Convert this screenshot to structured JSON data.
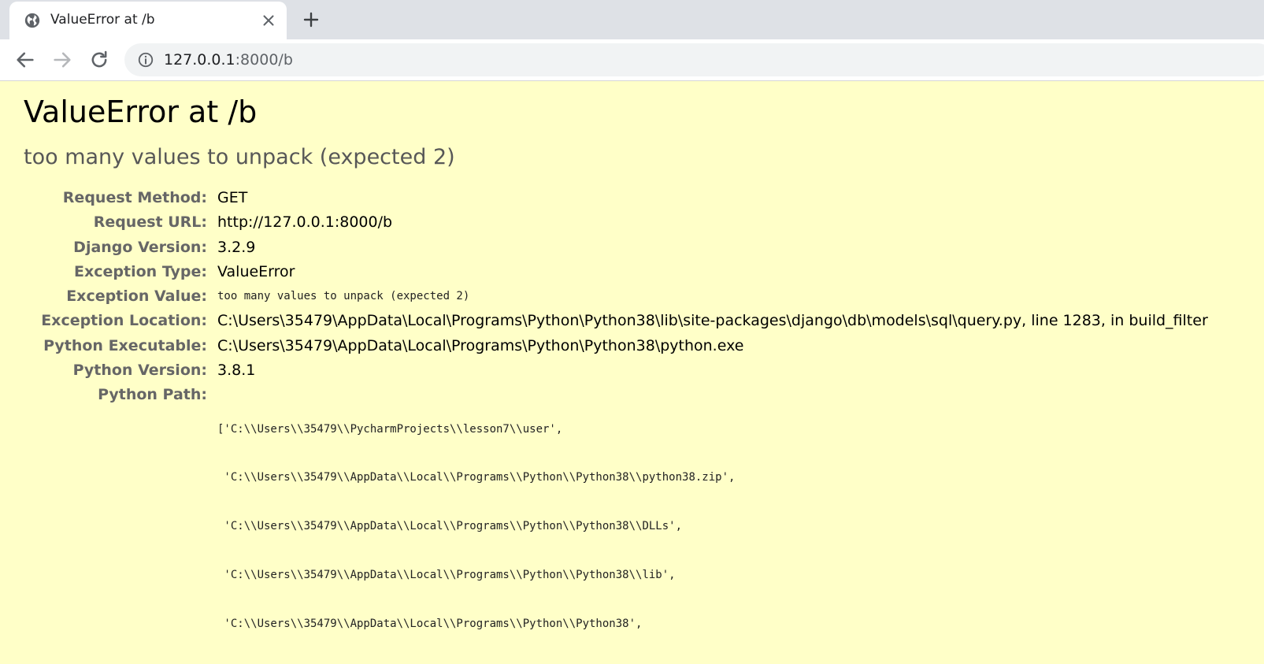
{
  "browser": {
    "tab_title": "ValueError at /b",
    "url_host": "127.0.0.1",
    "url_rest": ":8000/b"
  },
  "error": {
    "title": "ValueError at /b",
    "message": "too many values to unpack (expected 2)"
  },
  "meta": [
    {
      "label": "Request Method:",
      "value": "GET",
      "mono": false
    },
    {
      "label": "Request URL:",
      "value": "http://127.0.0.1:8000/b",
      "mono": false
    },
    {
      "label": "Django Version:",
      "value": "3.2.9",
      "mono": false
    },
    {
      "label": "Exception Type:",
      "value": "ValueError",
      "mono": false
    },
    {
      "label": "Exception Value:",
      "value": "too many values to unpack (expected 2)",
      "mono": true
    },
    {
      "label": "Exception Location:",
      "value": "C:\\Users\\35479\\AppData\\Local\\Programs\\Python\\Python38\\lib\\site-packages\\django\\db\\models\\sql\\query.py, line 1283, in build_filter",
      "mono": false
    },
    {
      "label": "Python Executable:",
      "value": "C:\\Users\\35479\\AppData\\Local\\Programs\\Python\\Python38\\python.exe",
      "mono": false
    },
    {
      "label": "Python Version:",
      "value": "3.8.1",
      "mono": false
    }
  ],
  "python_path": {
    "label": "Python Path:",
    "lines": [
      "['C:\\\\Users\\\\35479\\\\PycharmProjects\\\\lesson7\\\\user',",
      " 'C:\\\\Users\\\\35479\\\\AppData\\\\Local\\\\Programs\\\\Python\\\\Python38\\\\python38.zip',",
      " 'C:\\\\Users\\\\35479\\\\AppData\\\\Local\\\\Programs\\\\Python\\\\Python38\\\\DLLs',",
      " 'C:\\\\Users\\\\35479\\\\AppData\\\\Local\\\\Programs\\\\Python\\\\Python38\\\\lib',",
      " 'C:\\\\Users\\\\35479\\\\AppData\\\\Local\\\\Programs\\\\Python\\\\Python38',"
    ]
  }
}
